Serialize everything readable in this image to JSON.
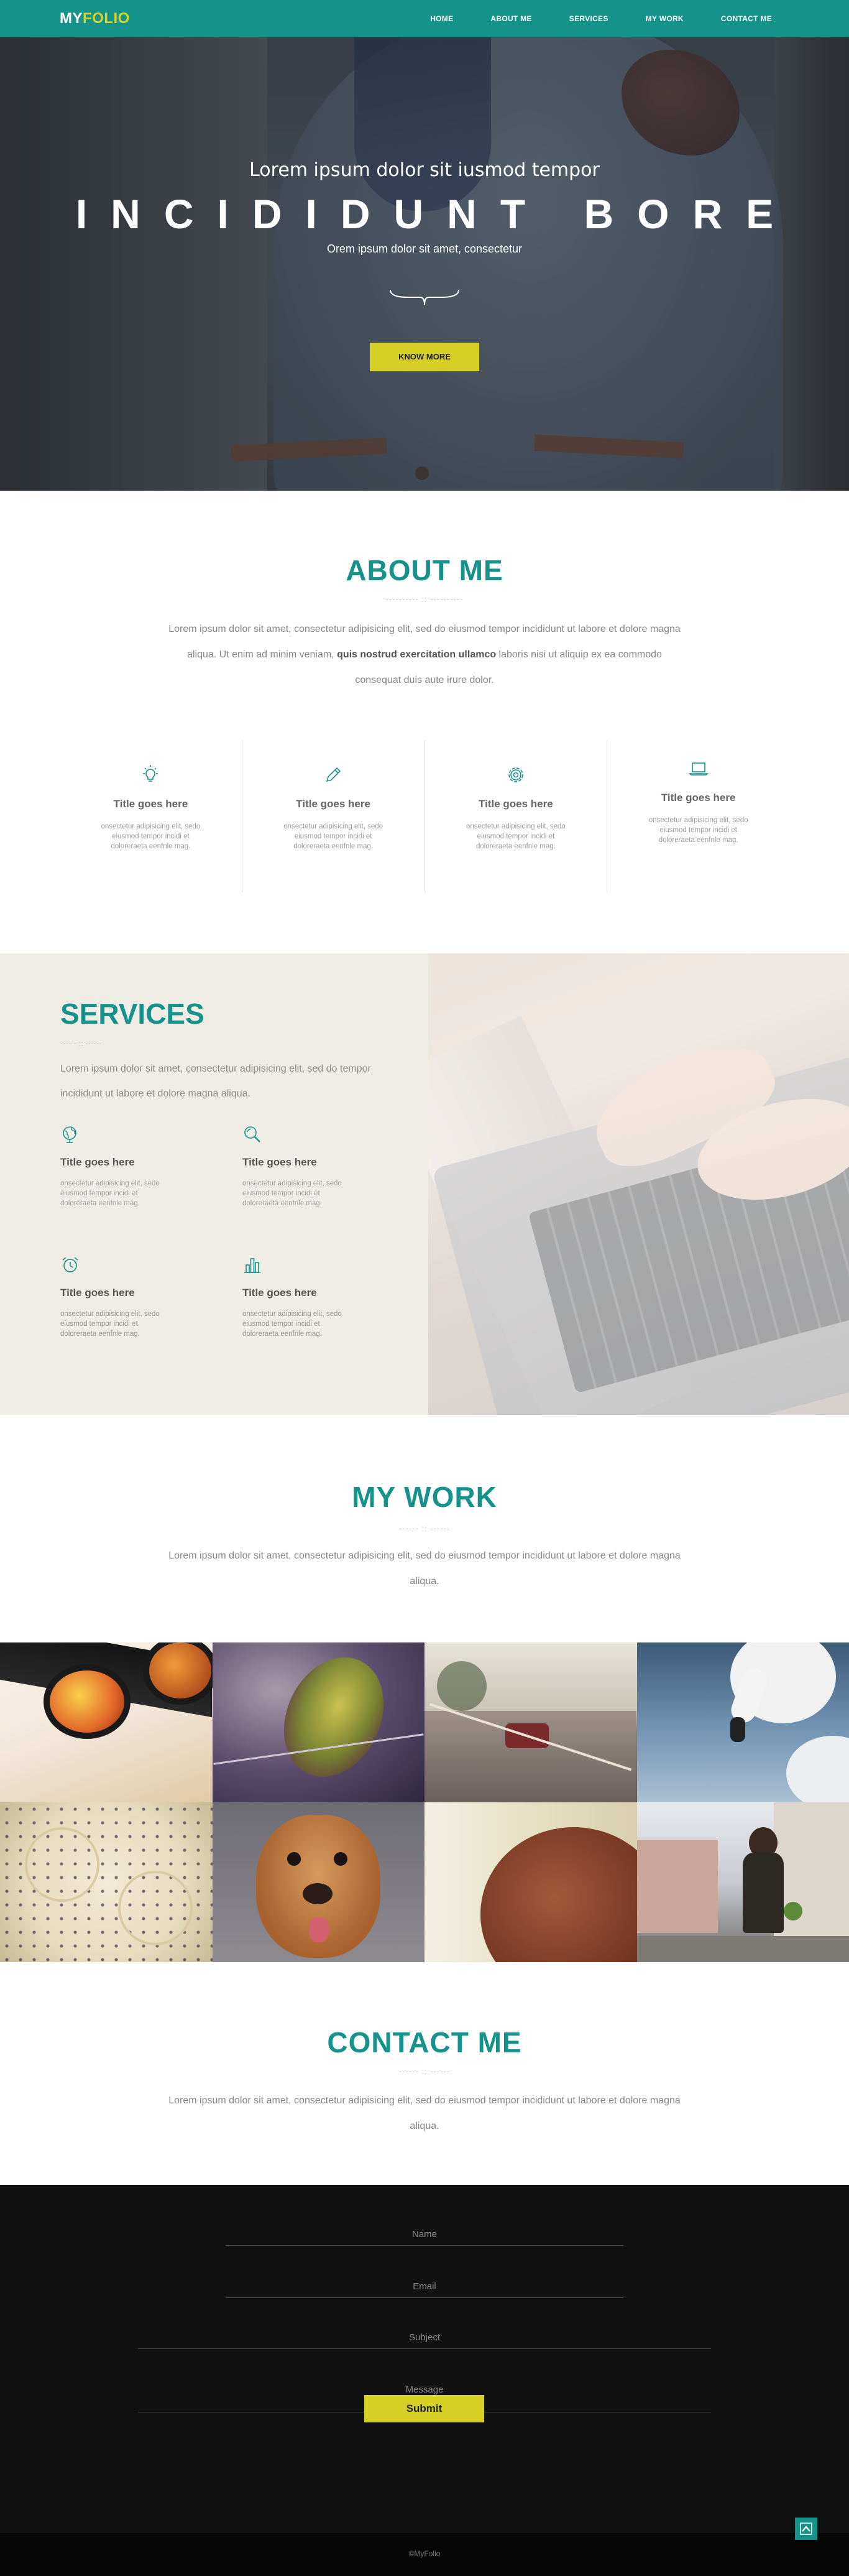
{
  "brand": {
    "logo_part1": "MY",
    "logo_part2": "FOLIO"
  },
  "nav": [
    "HOME",
    "ABOUT ME",
    "SERVICES",
    "MY WORK",
    "CONTACT ME"
  ],
  "hero": {
    "subtitle": "Lorem ipsum dolor sit iusmod tempor",
    "title": "INCIDIDUNT BORE",
    "tagline": "Orem ipsum dolor sit amet, consectetur",
    "cta": "KNOW MORE"
  },
  "about": {
    "title": "ABOUT ME",
    "divider": "---------- :: ----------",
    "text_a": "Lorem ipsum dolor sit amet, consectetur adipisicing elit, sed do eiusmod tempor incididunt ut labore et dolore magna aliqua. Ut enim ad minim veniam, ",
    "text_bold": "quis nostrud exercitation ullamco",
    "text_b": " laboris nisi ut aliquip ex ea commodo consequat duis aute irure dolor.",
    "features": [
      {
        "icon": "lightbulb-icon",
        "title": "Title goes here",
        "text": "onsectetur adipisicing elit, sedo eiusmod tempor incidi et doloreraeta eenfnle mag."
      },
      {
        "icon": "pencil-icon",
        "title": "Title goes here",
        "text": "onsectetur adipisicing elit, sedo eiusmod tempor incidi et doloreraeta eenfnle mag."
      },
      {
        "icon": "gear-icon",
        "title": "Title goes here",
        "text": "onsectetur adipisicing elit, sedo eiusmod tempor incidi et doloreraeta eenfnle mag."
      },
      {
        "icon": "laptop-icon",
        "title": "Title goes here",
        "text": "onsectetur adipisicing elit, sedo eiusmod tempor incidi et doloreraeta eenfnle mag."
      }
    ]
  },
  "services": {
    "title": "SERVICES",
    "divider": "------ :: ------",
    "text": "Lorem ipsum dolor sit amet, consectetur adipisicing elit, sed do tempor incididunt ut labore et dolore magna aliqua.",
    "items": [
      {
        "icon": "globe-icon",
        "title": "Title goes here",
        "text": "onsectetur adipisicing elit, sedo eiusmod tempor incidi et doloreraeta eenfnle mag."
      },
      {
        "icon": "magnifier-icon",
        "title": "Title goes here",
        "text": "onsectetur adipisicing elit, sedo eiusmod tempor incidi et doloreraeta eenfnle mag."
      },
      {
        "icon": "alarm-clock-icon",
        "title": "Title goes here",
        "text": "onsectetur adipisicing elit, sedo eiusmod tempor incidi et doloreraeta eenfnle mag."
      },
      {
        "icon": "bar-chart-icon",
        "title": "Title goes here",
        "text": "onsectetur adipisicing elit, sedo eiusmod tempor incidi et doloreraeta eenfnle mag."
      }
    ]
  },
  "work": {
    "title": "MY WORK",
    "divider": "------ :: ------",
    "text": "Lorem ipsum dolor sit amet, consectetur adipisicing elit, sed do eiusmod tempor incididunt ut labore et dolore magna aliqua.",
    "tiles": [
      "sunglasses-photo",
      "feather-photo",
      "road-car-photo",
      "swan-photo",
      "banana-photo",
      "dog-photo",
      "hair-photo",
      "street-woman-photo"
    ]
  },
  "contact": {
    "title": "CONTACT ME",
    "divider": "------ :: ------",
    "text": "Lorem ipsum dolor sit amet, consectetur adipisicing elit, sed do eiusmod tempor incididunt ut labore et dolore magna aliqua.",
    "name_placeholder": "Name",
    "email_placeholder": "Email",
    "subject_placeholder": "Subject",
    "message_placeholder": "Message",
    "submit": "Submit"
  },
  "footer": {
    "copyright": "©MyFolio"
  },
  "colors": {
    "accent": "#15928a",
    "cta": "#d5cf26",
    "dark": "#111111",
    "services_bg": "#efede6"
  }
}
